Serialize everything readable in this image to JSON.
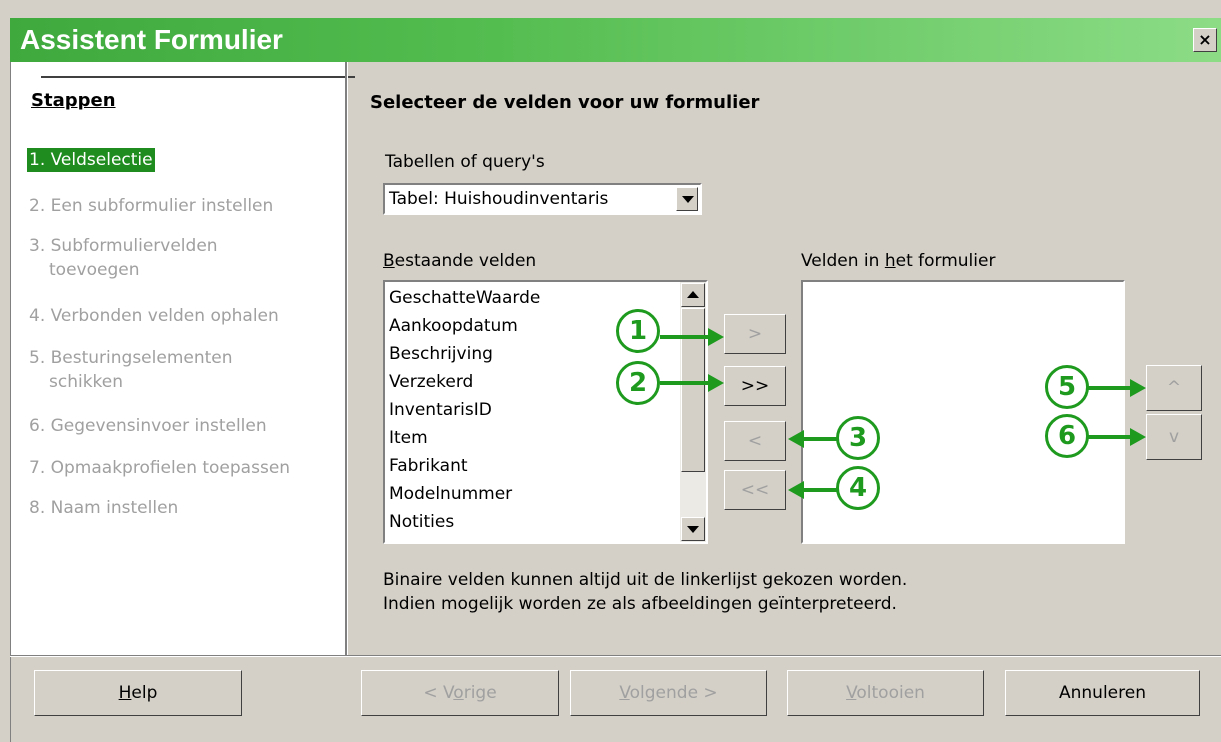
{
  "window": {
    "title": "Assistent Formulier",
    "close_label": "×"
  },
  "steps": {
    "title": "Stappen",
    "items": [
      {
        "label": "1. Veldselectie"
      },
      {
        "label": "2. Een subformulier instellen"
      },
      {
        "label": "3. Subformuliervelden"
      },
      {
        "label": "toevoegen"
      },
      {
        "label": "4. Verbonden velden ophalen"
      },
      {
        "label": "5. Besturingselementen"
      },
      {
        "label": "schikken"
      },
      {
        "label": "6. Gegevensinvoer instellen"
      },
      {
        "label": "7. Opmaakprofielen toepassen"
      },
      {
        "label": "8. Naam instellen"
      }
    ]
  },
  "main": {
    "heading": "Selecteer de velden voor uw formulier",
    "tables_label": "Tabellen of query's",
    "table_selected": "Tabel: Huishoudinventaris",
    "existing_fields_label_first": "B",
    "existing_fields_label_rest": "estaande velden",
    "form_fields_label_a": "Velden in ",
    "form_fields_label_u": "h",
    "form_fields_label_b": "et formulier",
    "existing_fields": [
      "GeschatteWaarde",
      "Aankoopdatum",
      "Beschrijving",
      "Verzekerd",
      "InventarisID",
      "Item",
      "Fabrikant",
      "Modelnummer",
      "Notities"
    ],
    "move_buttons": {
      "add_one": ">",
      "add_all": ">>",
      "remove_one": "<",
      "remove_all": "<<",
      "up": "^",
      "down": "v"
    },
    "info_line1": "Binaire velden kunnen altijd uit de linkerlijst gekozen worden.",
    "info_line2": "Indien mogelijk worden ze als afbeeldingen geïnterpreteerd."
  },
  "callouts": [
    "1",
    "2",
    "3",
    "4",
    "5",
    "6"
  ],
  "footer": {
    "help_pre": "",
    "help_u": "H",
    "help_post": "elp",
    "prev_pre": "< V",
    "prev_u": "o",
    "prev_post": "rige",
    "next_pre": "",
    "next_u": "V",
    "next_post": "olgende >",
    "finish_pre": "",
    "finish_u": "V",
    "finish_post": "oltooien",
    "cancel": "Annuleren"
  },
  "colors": {
    "accent_green": "#1e9a1e",
    "title_green": "#3fa93e"
  }
}
